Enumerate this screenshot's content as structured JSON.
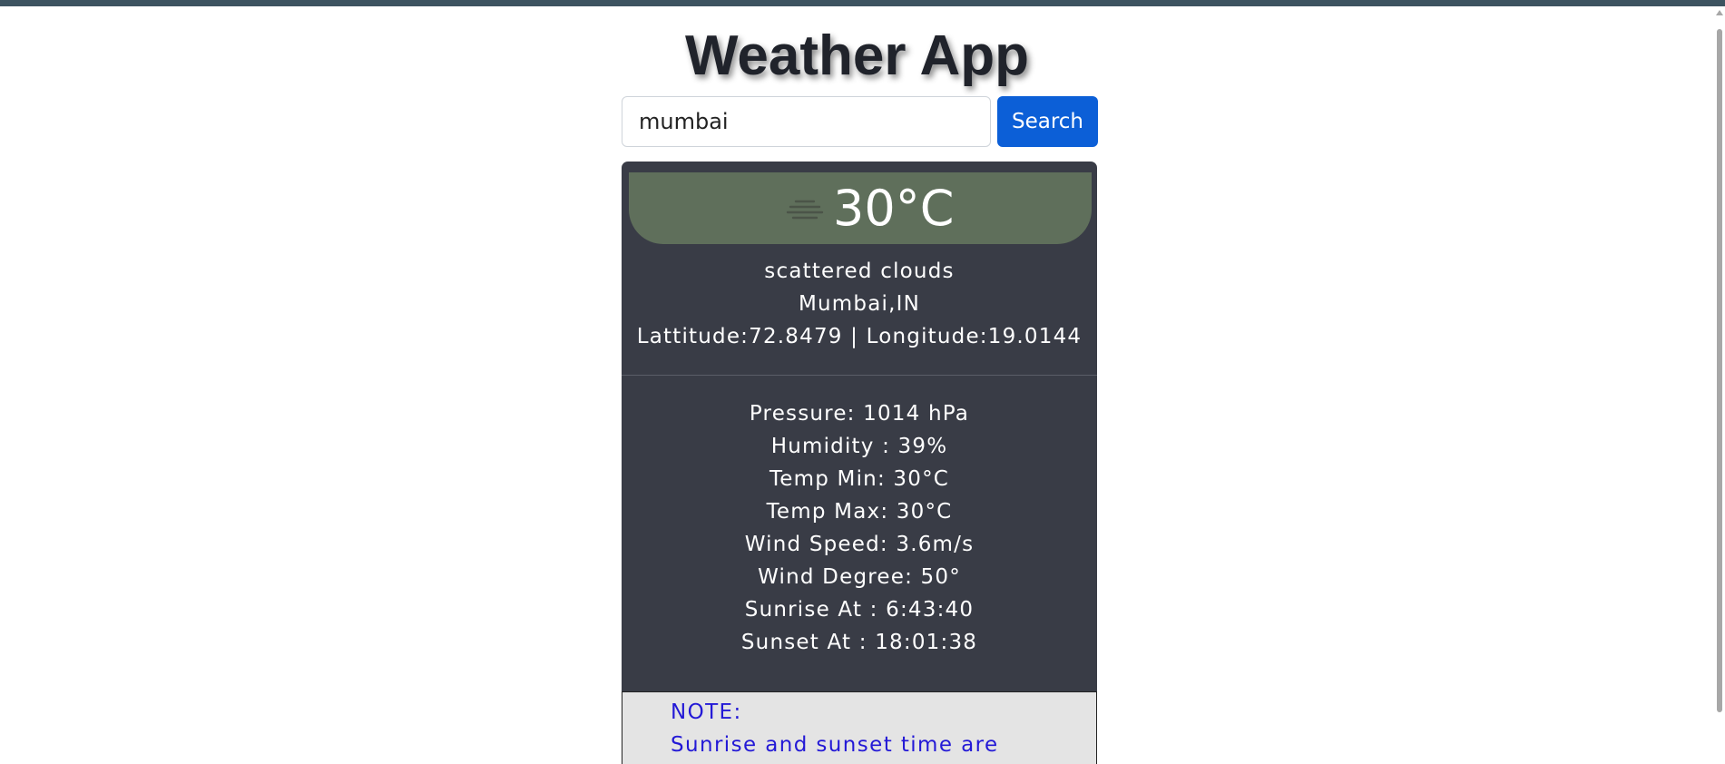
{
  "app": {
    "title": "Weather App"
  },
  "search": {
    "value": "mumbai",
    "placeholder": "",
    "button_label": "Search"
  },
  "weather": {
    "icon": "scattered-clouds-icon",
    "temperature": "30°C",
    "description": "scattered clouds",
    "location": "Mumbai,IN",
    "coordinates": "Lattitude:72.8479 | Longitude:19.0144"
  },
  "details": [
    "Pressure: 1014 hPa",
    "Humidity : 39%",
    "Temp Min: 30°C",
    "Temp Max: 30°C",
    "Wind Speed: 3.6m/s",
    "Wind Degree: 50°",
    "Sunrise At : 6:43:40",
    "Sunset At : 18:01:38"
  ],
  "note": {
    "heading": "NOTE:",
    "text": "Sunrise and sunset time are"
  },
  "colors": {
    "accent": "#0c5fd7",
    "card": "#393c46",
    "banner": "#5f6f5b",
    "note_text": "#2319d6"
  }
}
